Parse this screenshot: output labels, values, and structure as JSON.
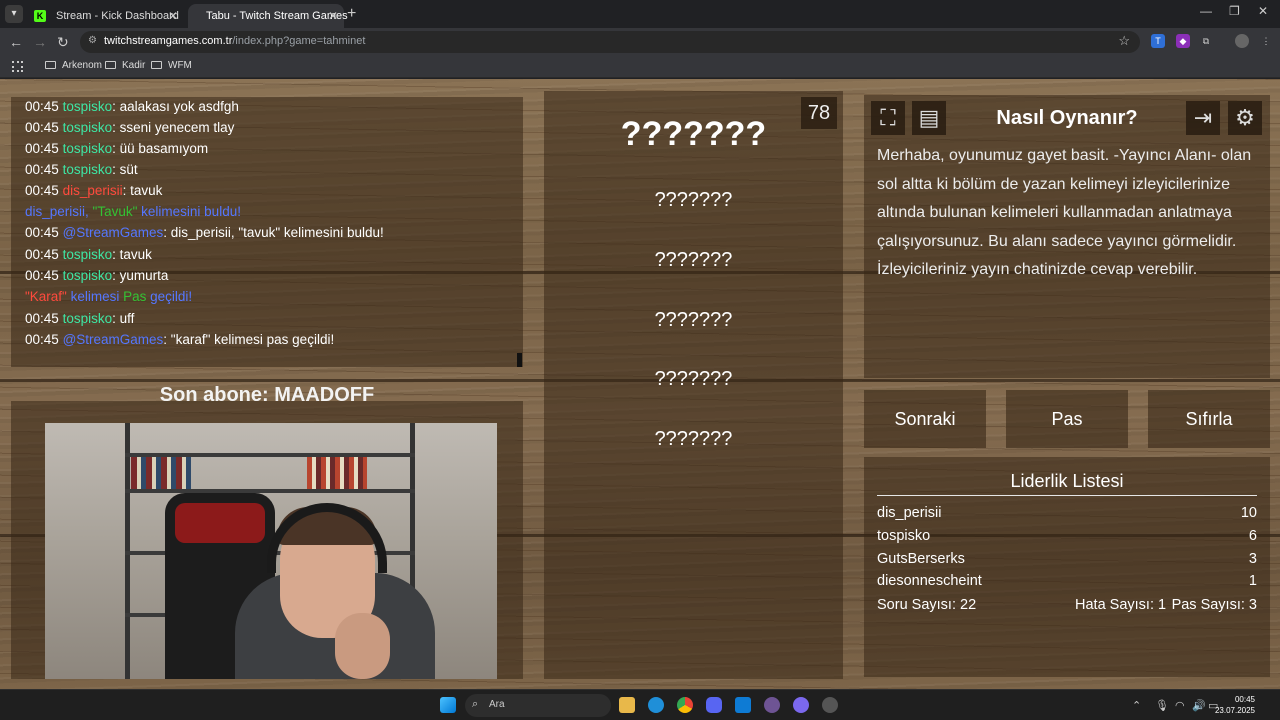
{
  "browser": {
    "tabs": [
      {
        "title": "Stream - Kick Dashboard"
      },
      {
        "title": "Tabu - Twitch Stream Games"
      }
    ],
    "new_tab": "+",
    "url_host": "twitchstreamgames.com.tr",
    "url_path": "/index.php?game=tahminet",
    "bookmarks": [
      "Arkenom",
      "Kadir",
      "WFM"
    ]
  },
  "chat": {
    "lines": [
      {
        "time": "00:45",
        "user": "tospisko",
        "text": ": aalakası yok asdfgh"
      },
      {
        "time": "00:45",
        "user": "tospisko",
        "text": ": sseni yenecem tlay"
      },
      {
        "time": "00:45",
        "user": "tospisko",
        "text": ": üü basamıyom"
      },
      {
        "time": "00:45",
        "user": "tospisko",
        "text": ": süt"
      },
      {
        "time": "00:45",
        "user": "dis_perisii",
        "text": ": tavuk"
      },
      {
        "user": "dis_perisii",
        "sep": ", ",
        "word": "\"Tavuk\"",
        "text": " kelimesini buldu!"
      },
      {
        "time": "00:45",
        "user": "@StreamGames",
        "text": ": dis_perisii, \"tavuk\" kelimesini buldu!"
      },
      {
        "time": "00:45",
        "user": "tospisko",
        "text": ": tavuk"
      },
      {
        "time": "00:45",
        "user": "tospisko",
        "text": ": yumurta"
      },
      {
        "word": "\"Karaf\"",
        "text": " kelimesi ",
        "status": "Pas",
        "text2": " geçildi!"
      },
      {
        "time": "00:45",
        "user": "tospisko",
        "text": ": uff"
      },
      {
        "time": "00:45",
        "user": "@StreamGames",
        "text": ": \"karaf\" kelimesi pas geçildi!"
      }
    ]
  },
  "last_sub": "Son abone: MAADOFF",
  "game": {
    "counter": "78",
    "main_word": "???????",
    "forbidden_words": [
      "???????",
      "???????",
      "???????",
      "???????",
      "???????"
    ]
  },
  "info": {
    "title": "Nasıl Oynanır?",
    "text": "Merhaba, oyunumuz gayet basit. -Yayıncı Alanı- olan sol altta ki bölüm de yazan kelimeyi izleyicilerinize altında bulunan kelimeleri kullanmadan anlatmaya çalışıyorsunuz. Bu alanı sadece yayıncı görmelidir. İzleyicileriniz yayın chatinizde cevap verebilir."
  },
  "actions": {
    "next": "Sonraki",
    "pass": "Pas",
    "reset": "Sıfırla"
  },
  "leaderboard": {
    "title": "Liderlik Listesi",
    "rows": [
      {
        "name": "dis_perisii",
        "score": "10"
      },
      {
        "name": "tospisko",
        "score": "6"
      },
      {
        "name": "GutsBerserks",
        "score": "3"
      },
      {
        "name": "diesonnescheint",
        "score": "1"
      }
    ],
    "stats": {
      "questions": "Soru Sayısı: 22",
      "errors": "Hata Sayısı: 1",
      "passes": "Pas Sayısı: 3"
    }
  },
  "taskbar": {
    "search_label": "Ara",
    "time": "00:45",
    "date": "23.07.2025"
  },
  "colors": {
    "user_green": "#3ee6a4",
    "user_red": "#ff4a3d",
    "system_blue": "#5577ff",
    "pass_green": "#34c234"
  },
  "icons": [
    "fullscreen-icon",
    "document-icon",
    "logout-icon",
    "gear-icon",
    "folder-icon",
    "search-icon",
    "star-icon"
  ]
}
